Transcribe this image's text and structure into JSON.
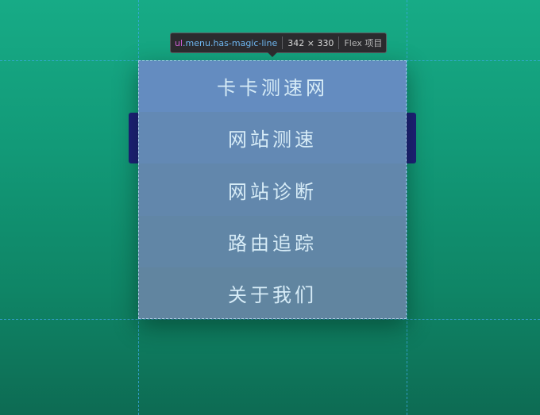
{
  "tooltip": {
    "tag": "ul",
    "classes": ".menu.has-magic-line",
    "size": "342 × 330",
    "type": "Flex 项目"
  },
  "menu": {
    "items": [
      {
        "label": "卡卡测速网"
      },
      {
        "label": "网站测速"
      },
      {
        "label": "网站诊断"
      },
      {
        "label": "路由追踪"
      },
      {
        "label": "关于我们"
      }
    ]
  },
  "colors": {
    "background_top": "#17ab86",
    "background_bottom": "#0d6b53",
    "menu_item": "#648cc0",
    "nav_bar": "#1e1f7a",
    "menu_text": "#d7ecf7",
    "tooltip_bg": "#2b2b2e"
  }
}
